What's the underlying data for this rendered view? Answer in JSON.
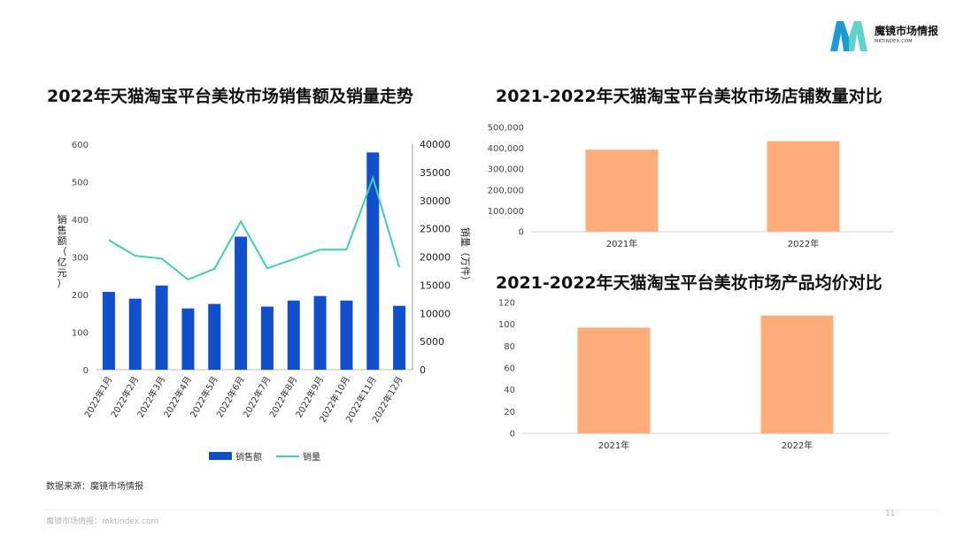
{
  "brand": {
    "name": "魔镜市场情报",
    "sub": "MKTINDEX.COM",
    "colors": {
      "m_left": "#1a9ad6",
      "m_right": "#5fd3c7"
    }
  },
  "colors": {
    "bar_blue": "#1150cc",
    "line_teal": "#3ecfb6",
    "bar_orange": "#ffad7a",
    "axis": "#bbbbbb"
  },
  "source": "数据来源：魔镜市场情报",
  "footer": {
    "text": "魔镜市场情报：mktindex.com",
    "page": "11"
  },
  "chart_data": [
    {
      "type": "bar",
      "title": "2022年天猫淘宝平台美妆市场销售额及销量走势",
      "categories": [
        "2022年1月",
        "2022年2月",
        "2022年3月",
        "2022年4月",
        "2022年5月",
        "2022年6月",
        "2022年7月",
        "2022年8月",
        "2022年9月",
        "2022年10月",
        "2022年11月",
        "2022年12月"
      ],
      "series": [
        {
          "name": "销售额",
          "type": "bar",
          "axis": "left",
          "values": [
            207,
            189,
            224,
            163,
            175,
            354,
            168,
            184,
            196,
            184,
            578,
            170
          ]
        },
        {
          "name": "销量",
          "type": "line",
          "axis": "right",
          "values": [
            23000,
            20200,
            19700,
            16000,
            17900,
            26300,
            18000,
            19600,
            21300,
            21300,
            34000,
            18200
          ]
        }
      ],
      "ylabel": "销售额（亿元）",
      "ylabel_right": "销量（万件）",
      "ylim": [
        0,
        600
      ],
      "ylim_right": [
        0,
        40000
      ],
      "yticks": [
        "0",
        "100",
        "200",
        "300",
        "400",
        "500",
        "600"
      ],
      "yticks_right": [
        "0",
        "5000",
        "10000",
        "15000",
        "20000",
        "25000",
        "30000",
        "35000",
        "40000"
      ],
      "legend_position": "bottom",
      "grid": false
    },
    {
      "type": "bar",
      "title": "2021-2022年天猫淘宝平台美妆市场店铺数量对比",
      "categories": [
        "2021年",
        "2022年"
      ],
      "values": [
        393000,
        434000
      ],
      "ylim": [
        0,
        500000
      ],
      "yticks": [
        "0",
        "100,000",
        "200,000",
        "300,000",
        "400,000",
        "500,000"
      ],
      "grid": false
    },
    {
      "type": "bar",
      "title": "2021-2022年天猫淘宝平台美妆市场产品均价对比",
      "categories": [
        "2021年",
        "2022年"
      ],
      "values": [
        97,
        108
      ],
      "ylim": [
        0,
        120
      ],
      "yticks": [
        "0",
        "20",
        "40",
        "60",
        "80",
        "100",
        "120"
      ],
      "grid": false
    }
  ]
}
